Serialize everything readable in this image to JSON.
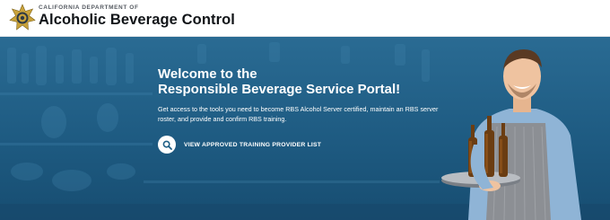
{
  "header": {
    "department": "CALIFORNIA DEPARTMENT OF",
    "agency": "Alcoholic Beverage Control"
  },
  "hero": {
    "title_line1": "Welcome to the",
    "title_line2": "Responsible Beverage Service Portal!",
    "description": "Get access to the tools you need to become RBS Alcohol Server certified, maintain an RBS server roster, and provide and confirm RBS training.",
    "cta_label": "VIEW APPROVED TRAINING PROVIDER LIST",
    "cta_icon": "search-icon"
  },
  "colors": {
    "hero_background": "#1f5f86",
    "badge_gold": "#c9a23a",
    "header_text": "#111418"
  }
}
